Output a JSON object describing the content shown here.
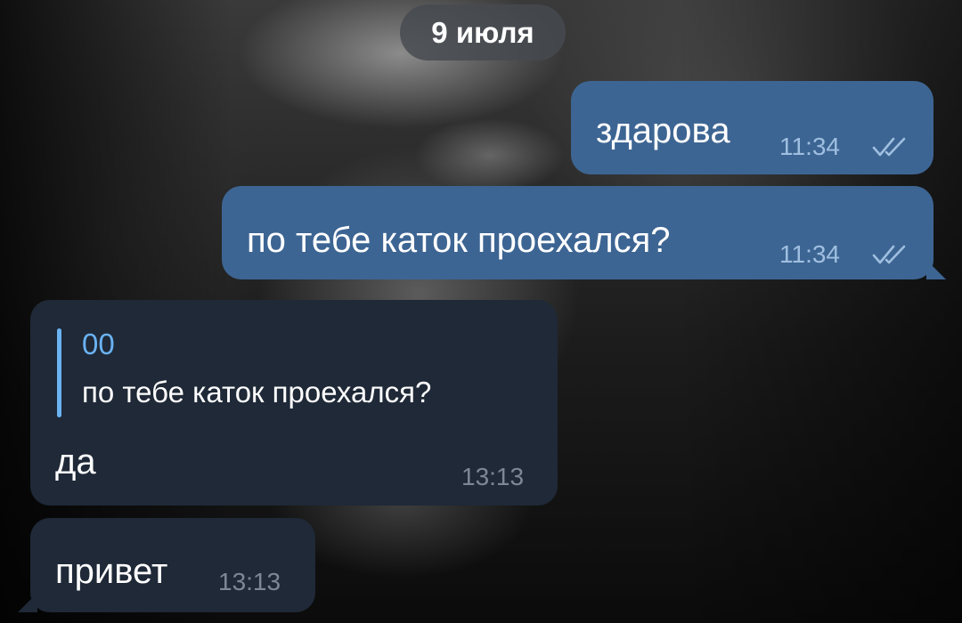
{
  "chat": {
    "date_label": "9 июля",
    "messages": [
      {
        "text": "здарова",
        "time": "11:34",
        "status": "read-double-check-icon"
      },
      {
        "text": "по тебе каток проехался?",
        "time": "11:34",
        "status": "read-double-check-icon"
      },
      {
        "reply": {
          "name": "00",
          "text": "по тебе каток проехался?"
        },
        "text": "да",
        "time": "13:13"
      },
      {
        "text": "привет",
        "time": "13:13"
      }
    ]
  },
  "colors": {
    "outgoing_bubble": "#3d6593",
    "incoming_bubble": "#1f2937",
    "reply_accent": "#6ab2f2",
    "date_pill": "#464a50"
  }
}
